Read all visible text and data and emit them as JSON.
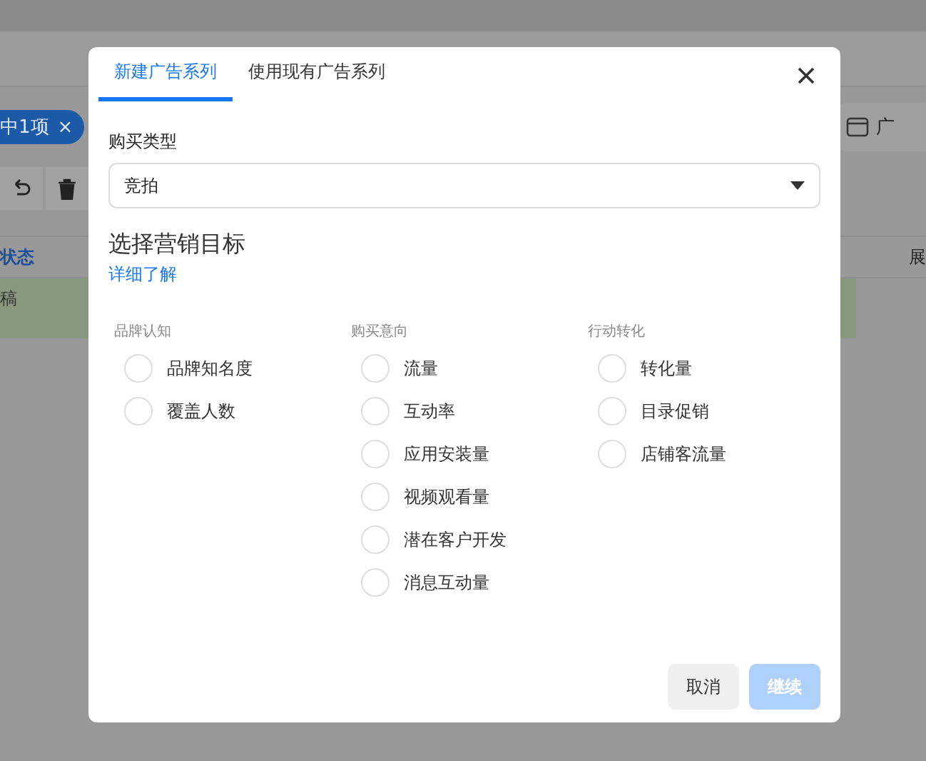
{
  "background": {
    "filter_chip": {
      "label": "中1项",
      "close": "×"
    },
    "table": {
      "columns": [
        "状态",
        "展"
      ],
      "rows": [
        [
          "稿"
        ]
      ]
    },
    "side_tab": {
      "label": "广"
    }
  },
  "dialog": {
    "tabs": [
      {
        "label": "新建广告系列",
        "selected": true
      },
      {
        "label": "使用现有广告系列",
        "selected": false
      }
    ],
    "purchase_type": {
      "label": "购买类型",
      "value": "竞拍"
    },
    "objective": {
      "title": "选择营销目标",
      "link": "详细了解"
    },
    "groups": [
      {
        "title": "品牌认知",
        "options": [
          {
            "label": "品牌知名度",
            "selected": false
          },
          {
            "label": "覆盖人数",
            "selected": false
          }
        ]
      },
      {
        "title": "购买意向",
        "options": [
          {
            "label": "流量",
            "selected": false
          },
          {
            "label": "互动率",
            "selected": false
          },
          {
            "label": "应用安装量",
            "selected": false
          },
          {
            "label": "视频观看量",
            "selected": false
          },
          {
            "label": "潜在客户开发",
            "selected": false
          },
          {
            "label": "消息互动量",
            "selected": false
          }
        ]
      },
      {
        "title": "行动转化",
        "options": [
          {
            "label": "转化量",
            "selected": false
          },
          {
            "label": "目录促销",
            "selected": false
          },
          {
            "label": "店铺客流量",
            "selected": false
          }
        ]
      }
    ],
    "buttons": [
      {
        "label": "取消",
        "kind": "secondary",
        "disabled": false
      },
      {
        "label": "继续",
        "kind": "primary",
        "disabled": true
      }
    ]
  }
}
